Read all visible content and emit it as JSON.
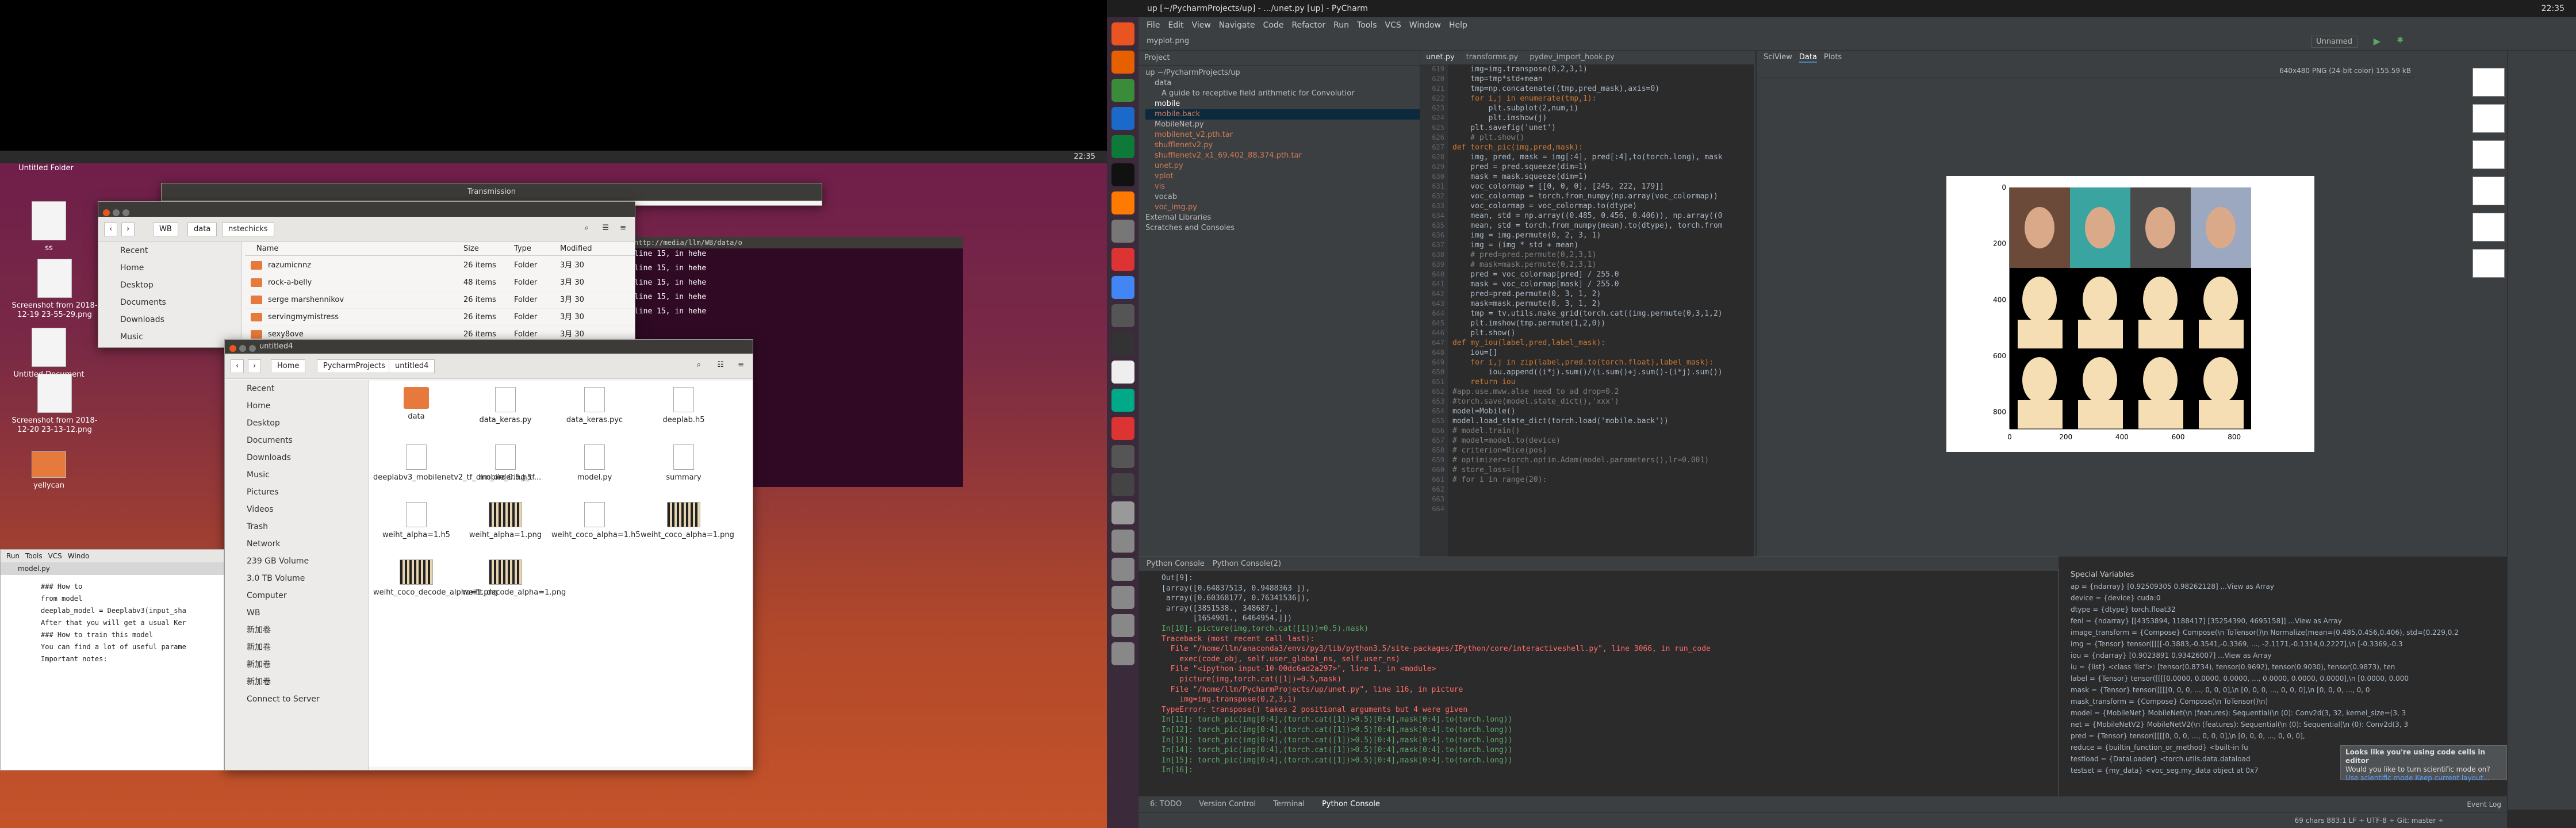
{
  "left_desktop": {
    "time": "22:35",
    "desktop_icons": [
      "Untitled Folder",
      "ss",
      "Screenshot from 2018-12-19 23-55-29.png",
      "Untitled Document",
      "Screenshot from 2018-12-20 23-13-12.png",
      "yellycan"
    ],
    "window_transmission": "Transmission",
    "window1": {
      "path": [
        "WB",
        "data",
        "nstechicks"
      ],
      "sidebar": [
        "Recent",
        "Home",
        "Desktop",
        "Documents",
        "Downloads",
        "Music",
        "Pictures",
        "Videos",
        "Trash",
        "Network",
        "239 GB Volume",
        "3.0 TB Volume",
        "Computer",
        "WB",
        "新加卷",
        "新加卷",
        "新加卷",
        "新加卷",
        "Connect to Server"
      ],
      "columns": [
        "Name",
        "Size",
        "Type",
        "Modified"
      ],
      "rows": [
        [
          "razumicnnz",
          "26 items",
          "Folder",
          "3月 30"
        ],
        [
          "rock-a-belly",
          "48 items",
          "Folder",
          "3月 30"
        ],
        [
          "serge marshennikov",
          "26 items",
          "Folder",
          "3月 30"
        ],
        [
          "servingmymistress",
          "26 items",
          "Folder",
          "3月 30"
        ],
        [
          "sexy8ove",
          "26 items",
          "Folder",
          "3月 30"
        ]
      ]
    },
    "terminal": {
      "title": "http://media/llm/WB/data/o",
      "lines": [
        "line 15, in hehe",
        "line 15, in hehe",
        "line 15, in hehe",
        "line 15, in hehe",
        "line 15, in hehe"
      ]
    },
    "window2": {
      "title": "untitled4",
      "path": [
        "Home",
        "PycharmProjects",
        "untitled4"
      ],
      "sidebar": [
        "Recent",
        "Home",
        "Desktop",
        "Documents",
        "Downloads",
        "Music",
        "Pictures",
        "Videos",
        "Trash",
        "Network",
        "239 GB Volume",
        "3.0 TB Volume",
        "Computer",
        "WB",
        "新加卷",
        "新加卷",
        "新加卷",
        "新加卷",
        "Connect to Server"
      ],
      "files": [
        {
          "name": "data",
          "kind": "folder"
        },
        {
          "name": "data_keras.py",
          "kind": "file"
        },
        {
          "name": "data_keras.pyc",
          "kind": "file"
        },
        {
          "name": "deeplab.h5",
          "kind": "file"
        },
        {
          "name": "deeplabv3_mobilenetv2_tf_dim_ordering_tf...",
          "kind": "file"
        },
        {
          "name": "mobile_0.5.h5",
          "kind": "file"
        },
        {
          "name": "model.py",
          "kind": "file"
        },
        {
          "name": "summary",
          "kind": "file"
        },
        {
          "name": "weiht_alpha=1.h5",
          "kind": "file"
        },
        {
          "name": "weiht_alpha=1.png",
          "kind": "img"
        },
        {
          "name": "weiht_coco_alpha=1.h5",
          "kind": "file"
        },
        {
          "name": "weiht_coco_alpha=1.png",
          "kind": "img"
        },
        {
          "name": "weiht_coco_decode_alpha=1.png",
          "kind": "img"
        },
        {
          "name": "weiht_decode_alpha=1.png",
          "kind": "img"
        }
      ]
    },
    "editor_peek": {
      "menu": [
        "Run",
        "Tools",
        "VCS",
        "Windo"
      ],
      "tab": "model.py",
      "lines": [
        "### How to",
        "from model",
        "deeplab_model = Deeplabv3(input_sha",
        "After that you will get a usual Ker",
        "### How to train this model",
        "You can find a lot of useful parame",
        "Important notes:"
      ]
    }
  },
  "right_desktop": {
    "clock": "22:35",
    "menu": [
      "File",
      "Edit",
      "View",
      "Navigate",
      "Code",
      "Refactor",
      "Run",
      "Tools",
      "VCS",
      "Window",
      "Help"
    ],
    "breadcrumb": "myplot.png",
    "run_config": "Unnamed",
    "project_header": "Project",
    "project_tree": [
      "up ~/PycharmProjects/up",
      "data",
      "A guide to receptive field arithmetic for Convolutior",
      "mobile",
      "mobile.back",
      "MobileNet.py",
      "mobilenet_v2.pth.tar",
      "shufflenetv2.py",
      "shufflenetv2_x1_69.402_88.374.pth.tar",
      "unet.py",
      "vplot",
      "vis",
      "vocab",
      "voc_img.py",
      "External Libraries",
      "Scratches and Consoles"
    ],
    "editor_tabs": [
      "unet.py",
      "transforms.py",
      "pydev_import_hook.py"
    ],
    "line_numbers_start": "619",
    "code_lines": [
      "    img=img.transpose(0,2,3,1)",
      "    tmp=tmp*std+mean",
      "    tmp=np.concatenate((tmp,pred_mask),axis=0)",
      "    for i,j in enumerate(tmp,1):",
      "        plt.subplot(2,num,i)",
      "        plt.imshow(j)",
      "    plt.savefig('unet')",
      "    # plt.show()",
      "def torch_pic(img,pred,mask):",
      "    img, pred, mask = img[:4], pred[:4],to(torch.long), mask",
      "    pred = pred.squeeze(dim=1)",
      "    mask = mask.squeeze(dim=1)",
      "    voc_colormap = [[0, 0, 0], [245, 222, 179]]",
      "    voc_colormap = torch.from_numpy(np.array(voc_colormap))",
      "    voc_colormap = voc_colormap.to(dtype)",
      "    mean, std = np.array((0.485, 0.456, 0.406)), np.array((0",
      "    mean, std = torch.from_numpy(mean).to(dtype), torch.from",
      "    img = img.permute(0, 2, 3, 1)",
      "    img = (img * std + mean)",
      "    # pred=pred.permute(0,2,3,1)",
      "    # mask=mask.permute(0,2,3,1)",
      "    pred = voc_colormap[pred] / 255.0",
      "    mask = voc_colormap[mask] / 255.0",
      "    pred=pred.permute(0, 3, 1, 2)",
      "    mask=mask.permute(0, 3, 1, 2)",
      "    tmp = tv.utils.make_grid(torch.cat((img.permute(0,3,1,2)",
      "    plt.imshow(tmp.permute(1,2,0))",
      "    plt.show()",
      "def my_iou(label,pred,label_mask):",
      "    iou=[]",
      "    for i,j in zip(label,pred.to(torch.float),label_mask):",
      "        iou.append((i*j).sum()/(i.sum()+j.sum()-(i*j).sum())",
      "    return iou",
      "",
      "#app.use.mww.alse need to ad drop=0.2",
      "",
      "#torch.save(model.state_dict(),'xxx')",
      "model=Mobile()",
      "model.load_state_dict(torch.load('mobile.back'))",
      "",
      "# model.train()",
      "# model=model.to(device)",
      "# criterion=Dice(pos)",
      "# optimizer=torch.optim.Adam(model.parameters(),lr=0.001)",
      "# store_loss=[]",
      "# for i in range(20):"
    ],
    "sciview": {
      "tabs": [
        "SciView",
        "Data",
        "Plots"
      ],
      "image_info": "640x480 PNG (24-bit color) 155.59 kB"
    },
    "chart_data": {
      "type": "image",
      "x_ticks": [
        "0",
        "200",
        "400",
        "600",
        "800"
      ],
      "y_ticks": [
        "0",
        "200",
        "400",
        "600",
        "800"
      ]
    },
    "console": {
      "tabs": [
        "Python Console",
        "Python Console(2)"
      ],
      "lines": [
        "Out[9]:",
        "[array([0.64837513, 0.9488363 ]),",
        " array([0.60368177, 0.76341536]),",
        " array([3851538., 348687.],",
        "       [1654901., 6464954.]])",
        "In[10]: picture(img,torch.cat([1]))=0.5).mask)",
        "Traceback (most recent call last):",
        "  File \"/home/llm/anaconda3/envs/py3/lib/python3.5/site-packages/IPython/core/interactiveshell.py\", line 3066, in run_code",
        "    exec(code_obj, self.user_global_ns, self.user_ns)",
        "  File \"<ipython-input-10-00dc6ad2a297>\", line 1, in <module>",
        "    picture(img,torch.cat([1])=0.5,mask)",
        "  File \"/home/llm/PycharmProjects/up/unet.py\", line 116, in picture",
        "    img=img.transpose(0,2,3,1)",
        "TypeError: transpose() takes 2 positional arguments but 4 were given",
        "In[11]: torch_pic(img[0:4],(torch.cat([1])>0.5)[0:4],mask[0:4].to(torch.long))",
        "In[12]: torch_pic(img[0:4],(torch.cat([1])>0.5)[0:4],mask[0:4].to(torch.long))",
        "In[13]: torch_pic(img[0:4],(torch.cat([1])>0.5)[0:4],mask[0:4].to(torch.long))",
        "In[14]: torch_pic(img[0:4],(torch.cat([1])>0.5)[0:4],mask[0:4].to(torch.long))",
        "In[15]: torch_pic(img[0:4],(torch.cat([1])>0.5)[0:4],mask[0:4].to(torch.long))",
        "In[16]:"
      ]
    },
    "variables_header": "Special Variables",
    "variables": [
      "ap = {ndarray} [0.92509305 0.98262128] ...View as Array",
      "device = {device} cuda:0",
      "dtype = {dtype} torch.float32",
      "fenl = {ndarray} [[4353894, 1188417] [35254390, 4695158]] ...View as Array",
      "image_transform = {Compose} Compose(\\n ToTensor()\\n Normalize(mean=(0.485,0.456,0.406), std=(0.229,0.2",
      "img = {Tensor} tensor([[[[-0.3883,-0.3541,-0.3369, ..., -2.1171,-0.1314,0.2227],\\n [-0.3369,-0.3",
      "iou = {ndarray} [0.9023891 0.93426007] ...View as Array",
      "iu = {list} <class 'list'>: [tensor(0.8734), tensor(0.9692), tensor(0.9030), tensor(0.9873), ten",
      "label = {Tensor} tensor([[[[0.0000, 0.0000, 0.0000, ..., 0.0000, 0.0000, 0.0000],\\n [0.0000, 0.000",
      "mask = {Tensor} tensor([[[[0, 0, 0, ..., 0, 0, 0],\\n [0, 0, 0, ..., 0, 0, 0],\\n [0, 0, 0, ..., 0, 0",
      "mask_transform = {Compose} Compose(\\n ToTensor()\\n)",
      "model = {MobileNet} MobileNet(\\n (features): Sequential(\\n (0): Conv2d(3, 32, kernel_size=(3, 3",
      "net = {MobileNetV2} MobileNetV2(\\n (features): Sequential(\\n (0): Sequential(\\n (0): Conv2d(3, 3",
      "pred = {Tensor} tensor([[[[0, 0, 0, ..., 0, 0, 0],\\n [0, 0, 0, ..., 0, 0, 0],",
      "reduce = {builtin_function_or_method} <built-in fu",
      "testload = {DataLoader} <torch.utils.data.dataload",
      "testset = {my_data} <voc_seg.my_data object at 0x7"
    ],
    "notification": {
      "title": "Looks like you're using code cells in editor",
      "body": "Would you like to turn scientific mode on?",
      "links": "Use scientific mode   Keep current layout..."
    },
    "bottom_tabs": [
      "6: TODO",
      "Version Control",
      "Terminal",
      "Python Console"
    ],
    "statusbar": {
      "left": "",
      "right": "69 chars  883:1  LF ÷  UTF-8 ÷  Git: master ÷"
    },
    "event_log": "Event Log",
    "ide_title": "up [~/PycharmProjects/up] - .../unet.py [up] - PyCharm"
  }
}
